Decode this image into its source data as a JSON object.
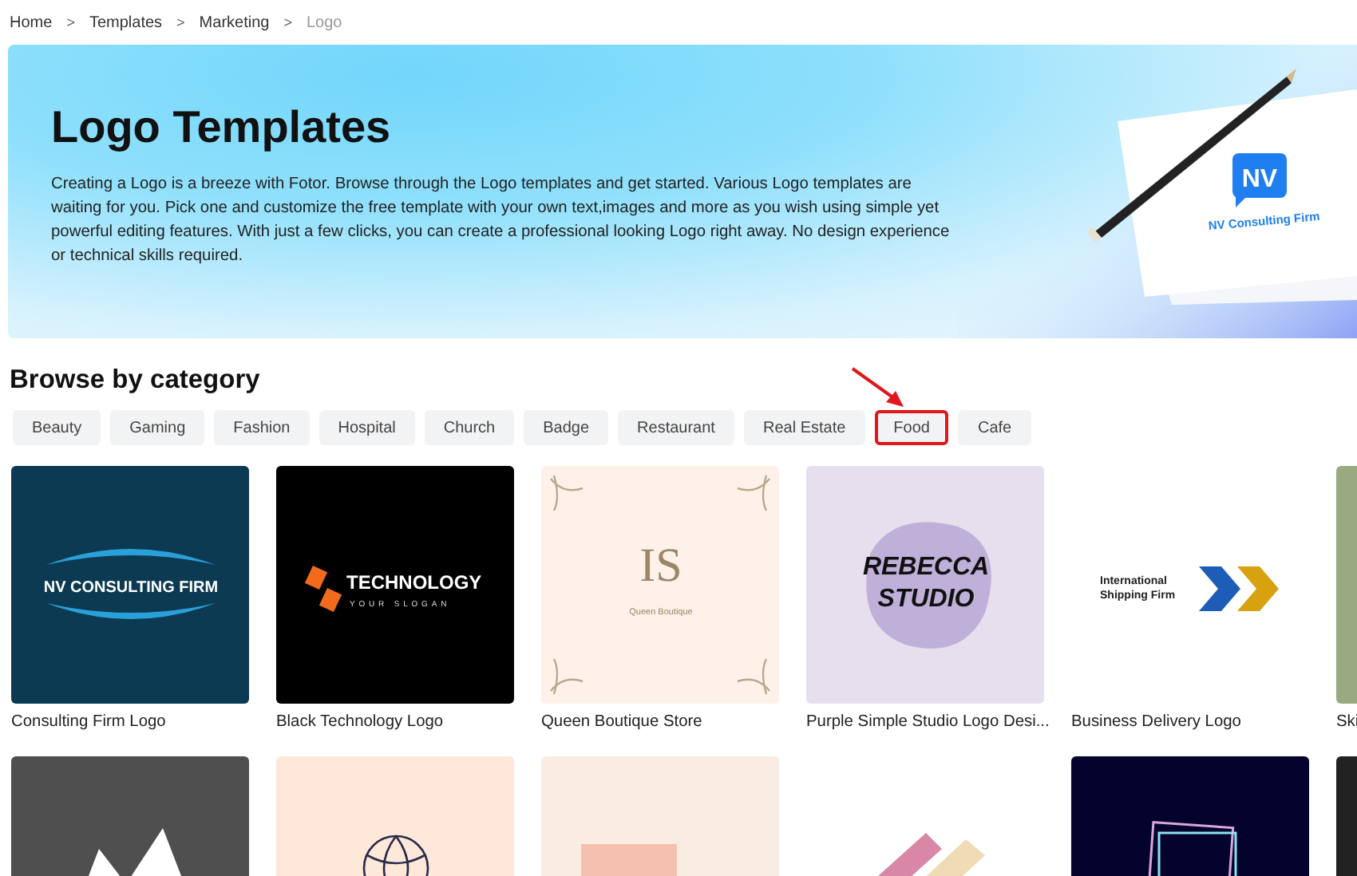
{
  "breadcrumb": [
    {
      "label": "Home",
      "current": false
    },
    {
      "label": "Templates",
      "current": false
    },
    {
      "label": "Marketing",
      "current": false
    },
    {
      "label": "Logo",
      "current": true
    }
  ],
  "breadcrumb_separator": ">",
  "hero": {
    "title": "Logo Templates",
    "description": "Creating a Logo is a breeze with Fotor. Browse through the Logo templates and get started. Various Logo templates are waiting for you. Pick one and customize the free template with your own text,images and more as you wish using simple yet powerful editing features. With just a few clicks, you can create a professional looking Logo right away. No design experience or technical skills required.",
    "badge": "NV",
    "brand": "NV Consulting Firm"
  },
  "browse": {
    "heading": "Browse by category",
    "categories": [
      {
        "label": "Beauty",
        "highlighted": false
      },
      {
        "label": "Gaming",
        "highlighted": false
      },
      {
        "label": "Fashion",
        "highlighted": false
      },
      {
        "label": "Hospital",
        "highlighted": false
      },
      {
        "label": "Church",
        "highlighted": false
      },
      {
        "label": "Badge",
        "highlighted": false
      },
      {
        "label": "Restaurant",
        "highlighted": false
      },
      {
        "label": "Real Estate",
        "highlighted": false
      },
      {
        "label": "Food",
        "highlighted": true
      },
      {
        "label": "Cafe",
        "highlighted": false
      }
    ]
  },
  "templates": [
    {
      "kind": "consulting",
      "title": "Consulting Firm Logo",
      "logo_lines": [
        "NV CONSULTING FIRM"
      ]
    },
    {
      "kind": "technology",
      "title": "Black Technology Logo",
      "logo_lines": [
        "TECHNOLOGY",
        "YOUR SLOGAN"
      ]
    },
    {
      "kind": "boutique",
      "title": "Queen Boutique Store",
      "logo_lines": [
        "IS",
        "Queen Boutique"
      ]
    },
    {
      "kind": "studio",
      "title": "Purple Simple Studio Logo Desi...",
      "logo_lines": [
        "REBECCA",
        "STUDIO"
      ]
    },
    {
      "kind": "shipping",
      "title": "Business Delivery Logo",
      "logo_lines": [
        "International",
        "Shipping Firm"
      ]
    },
    {
      "kind": "green",
      "title": "Ski"
    },
    {
      "kind": "mountain"
    },
    {
      "kind": "lotus"
    },
    {
      "kind": "music"
    },
    {
      "kind": "brush"
    },
    {
      "kind": "frame"
    },
    {
      "kind": "dark"
    }
  ]
}
